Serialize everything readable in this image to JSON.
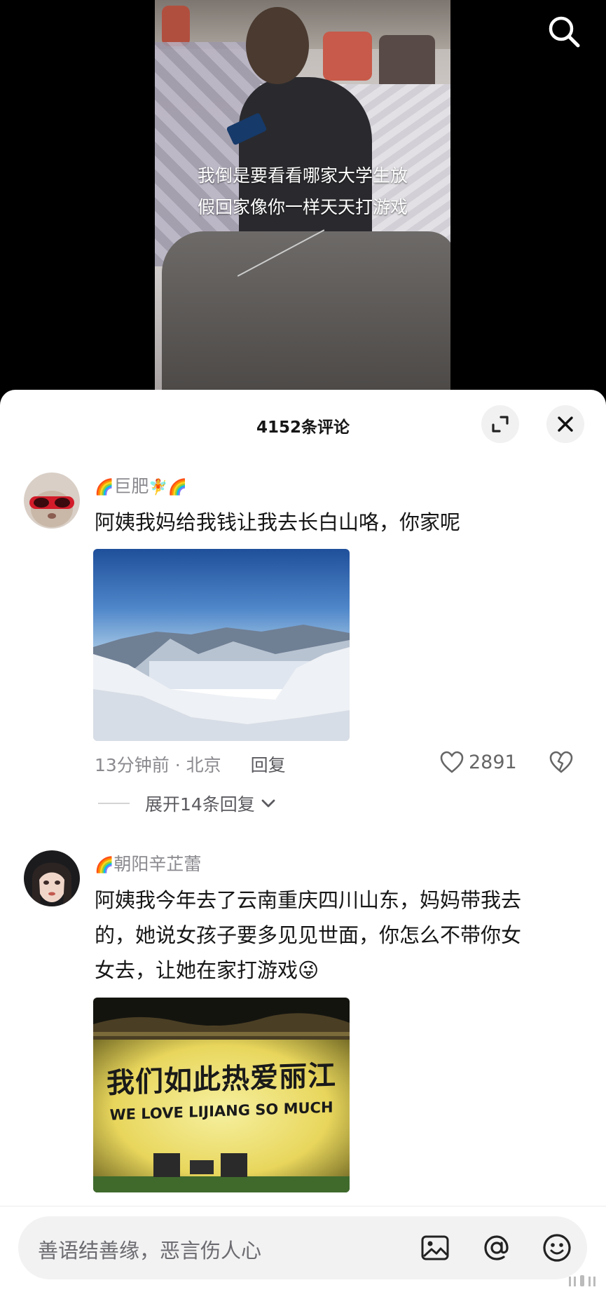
{
  "video": {
    "caption_line1": "我倒是要看看哪家大学生放",
    "caption_line2": "假回家像你一样天天打游戏"
  },
  "comments_panel": {
    "title": "4152条评论"
  },
  "comments": [
    {
      "nickname": "巨肥",
      "nickname_prefix": "🌈",
      "nickname_suffix": "🧚🌈",
      "text": "阿姨我妈给我钱让我去长白山咯，你家呢",
      "time": "13分钟前",
      "location": "北京",
      "reply_label": "回复",
      "likes": "2891",
      "expand_replies": "展开14条回复"
    },
    {
      "nickname": "朝阳辛芷蕾",
      "nickname_prefix": "🌈",
      "text_line1": "阿姨我今年去了云南重庆四川山东，妈妈带我去",
      "text_line2": "的，她说女孩子要多见见世面，你怎么不带你女",
      "text_line3": "女去，让她在家打游戏",
      "emoji": "😜",
      "photo_text_cn": "我们如此热爱丽江",
      "photo_text_en": "WE LOVE LIJIANG SO MUCH"
    }
  ],
  "input": {
    "placeholder": "善语结善缘，恶言伤人心"
  },
  "colors": {
    "sheet_bg": "#ffffff",
    "text_primary": "#161616",
    "text_secondary": "#8a8a8f"
  }
}
